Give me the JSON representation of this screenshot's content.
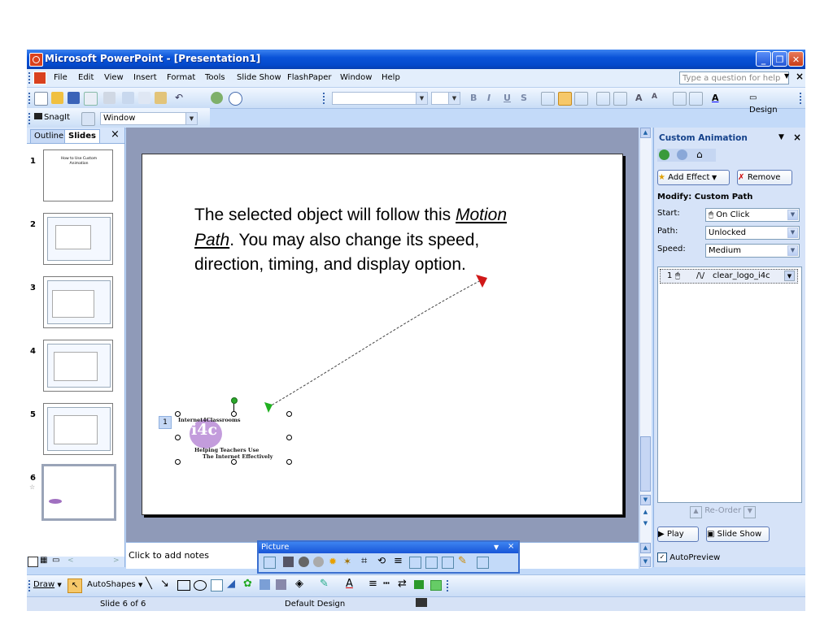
{
  "window": {
    "title": "Microsoft PowerPoint - [Presentation1]"
  },
  "menu": [
    "File",
    "Edit",
    "View",
    "Insert",
    "Format",
    "Tools",
    "Slide Show",
    "FlashPaper",
    "Window",
    "Help"
  ],
  "ask_placeholder": "Type a question for help",
  "toolbar2": {
    "design_label": "Design"
  },
  "snagit": {
    "label": "SnagIt",
    "combo": "Window"
  },
  "left_tabs": {
    "outline": "Outline",
    "slides": "Slides",
    "close": "×"
  },
  "thumbnails": [
    {
      "num": "1",
      "text": "How to Use Custom Animation"
    },
    {
      "num": "2"
    },
    {
      "num": "3"
    },
    {
      "num": "4"
    },
    {
      "num": "5"
    },
    {
      "num": "6"
    }
  ],
  "slide": {
    "text_part1": "The selected object will follow this ",
    "motion_path": "Motion Path",
    "text_part2": ".  You may also change its speed, direction, timing, and display option.",
    "anim_tag": "1",
    "logo_top": "Internet4Classrooms",
    "logo_mid": "i4c",
    "logo_line1": "Helping Teachers Use",
    "logo_line2": "The Internet Effectively"
  },
  "notes_placeholder": "Click to add notes",
  "task_pane": {
    "title": "Custom Animation",
    "add_effect": "Add Effect",
    "remove": "Remove",
    "modify_label": "Modify: Custom Path",
    "start_label": "Start:",
    "start_value": "On Click",
    "path_label": "Path:",
    "path_value": "Unlocked",
    "speed_label": "Speed:",
    "speed_value": "Medium",
    "item_num": "1",
    "item_name": "clear_logo_i4c",
    "reorder": "Re-Order",
    "play": "Play",
    "slideshow": "Slide Show",
    "autopreview": "AutoPreview"
  },
  "picture_toolbar": {
    "title": "Picture"
  },
  "drawbar": {
    "draw": "Draw",
    "autoshapes": "AutoShapes"
  },
  "status": {
    "slide": "Slide 6 of 6",
    "design": "Default Design"
  },
  "colors": {
    "title_bar": "#0a53d8",
    "workspace": "#8f9ab8",
    "task_pane": "#d6e3f8"
  }
}
